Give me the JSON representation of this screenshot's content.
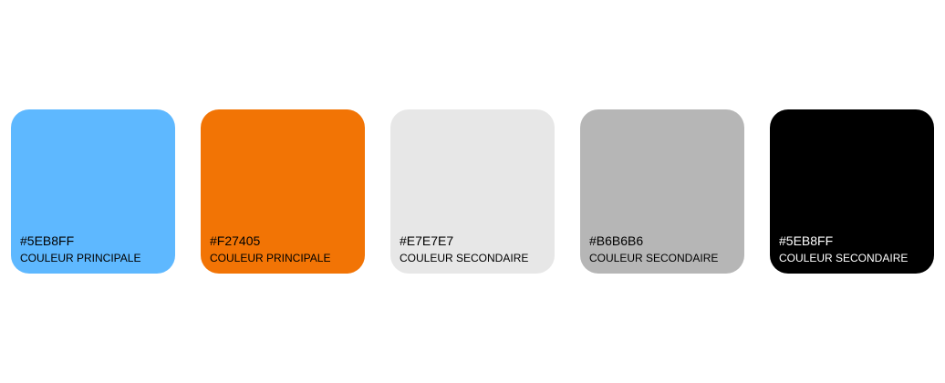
{
  "swatches": [
    {
      "hex": "#5EB8FF",
      "label": "COULEUR PRINCIPALE",
      "fill": "#5EB8FF",
      "text_color": "#000000"
    },
    {
      "hex": "#F27405",
      "label": "COULEUR PRINCIPALE",
      "fill": "#F27405",
      "text_color": "#000000"
    },
    {
      "hex": "#E7E7E7",
      "label": "COULEUR SECONDAIRE",
      "fill": "#E7E7E7",
      "text_color": "#000000"
    },
    {
      "hex": "#B6B6B6",
      "label": "COULEUR SECONDAIRE",
      "fill": "#B6B6B6",
      "text_color": "#000000"
    },
    {
      "hex": "#5EB8FF",
      "label": "COULEUR SECONDAIRE",
      "fill": "#000000",
      "text_color": "#FFFFFF"
    }
  ]
}
